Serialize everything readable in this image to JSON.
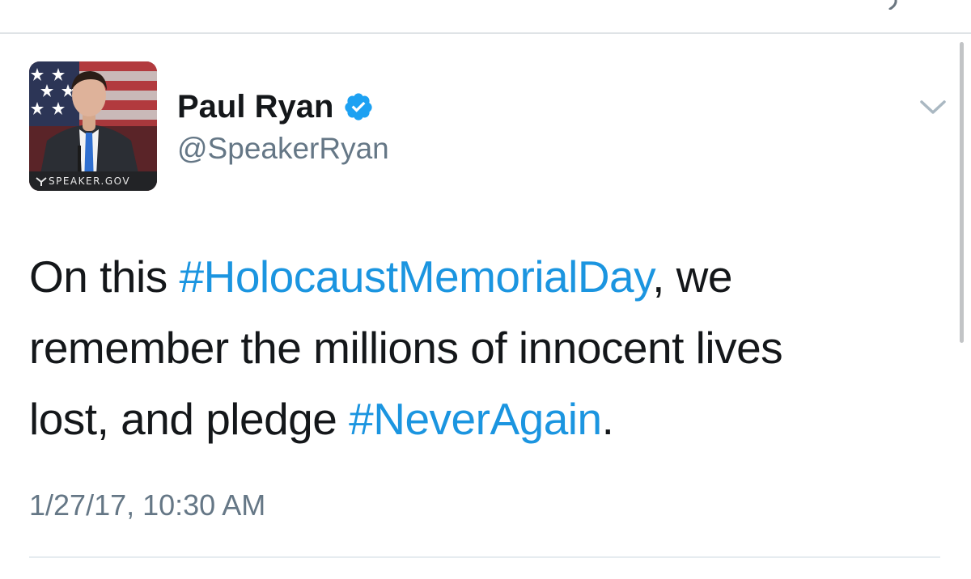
{
  "tweet": {
    "author": {
      "display_name": "Paul Ryan",
      "handle": "@SpeakerRyan",
      "verified": true,
      "avatar_caption": "SPEAKER.GOV"
    },
    "text": {
      "line1_a": "On this ",
      "line1_hashtag": "#HolocaustMemorialDay",
      "line1_b": ", we",
      "line2": "remember the millions of innocent lives",
      "line3_a": "lost, and pledge ",
      "line3_hashtag": "#NeverAgain",
      "line3_b": "."
    },
    "timestamp": "1/27/17, 10:30 AM"
  },
  "icons": {
    "verified": "verified-badge-icon",
    "more": "chevron-down-icon"
  },
  "colors": {
    "hashtag": "#1b95e0",
    "verified": "#1da1f2",
    "secondary_text": "#657786",
    "primary_text": "#14171a",
    "divider": "#e6ecf0"
  }
}
